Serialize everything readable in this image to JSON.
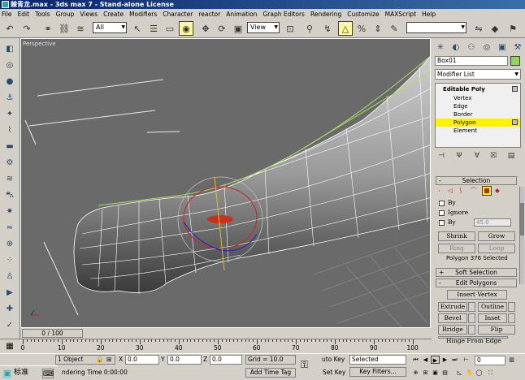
{
  "window": {
    "title": "棘青龙.max - 3ds max 7 - Stand-alone License"
  },
  "menu": [
    "File",
    "Edit",
    "Tools",
    "Group",
    "Views",
    "Create",
    "Modifiers",
    "Character",
    "reactor",
    "Animation",
    "Graph Editors",
    "Rendering",
    "Customize",
    "MAXScript",
    "Help"
  ],
  "toolbar": {
    "selection_filter": "All",
    "ref_coord": "View"
  },
  "viewport": {
    "label": "Perspective"
  },
  "command_panel": {
    "object_name": "Box01",
    "object_color": "#8fd65a",
    "modifier_list": "Modifier List",
    "stack": [
      {
        "label": "Editable Poly"
      },
      {
        "label": "Vertex"
      },
      {
        "label": "Edge"
      },
      {
        "label": "Border"
      },
      {
        "label": "Polygon"
      },
      {
        "label": "Element"
      }
    ],
    "selection": {
      "title": "Selection",
      "by_vertex": "By",
      "ignore": "Ignore",
      "by_angle": "By",
      "angle_value": "45.0",
      "shrink": "Shrink",
      "grow": "Grow",
      "ring": "Ring",
      "loop": "Loop",
      "status": "Polygon 376 Selected"
    },
    "soft_selection": {
      "title": "Soft Selection"
    },
    "edit_polygons": {
      "title": "Edit Polygons",
      "insert_vertex": "Insert Vertex",
      "extrude": "Extrude",
      "outline": "Outline",
      "bevel": "Bevel",
      "inset": "Inset",
      "bridge": "Bridge",
      "flip": "Flip",
      "hinge": "Hinge From Edge"
    }
  },
  "timeline": {
    "slider": "0 / 100",
    "ticks": [
      "0",
      "10",
      "20",
      "30",
      "40",
      "50",
      "60",
      "70",
      "80",
      "90",
      "100"
    ]
  },
  "status": {
    "objects": "1 Object",
    "x_label": "X",
    "x_value": "0.0",
    "y_label": "Y",
    "y_value": "0.0",
    "z_label": "Z",
    "z_value": "0.0",
    "grid": "Grid = 10.0",
    "auto_key": "uto Key",
    "key_mode": "Selected",
    "set_key": "Set Key",
    "key_filters": "Key Filters...",
    "rendering_time": "ndering Time  0:00:00",
    "add_time_tag": "Add Time Tag",
    "frame": "0",
    "start_label": "标准"
  }
}
